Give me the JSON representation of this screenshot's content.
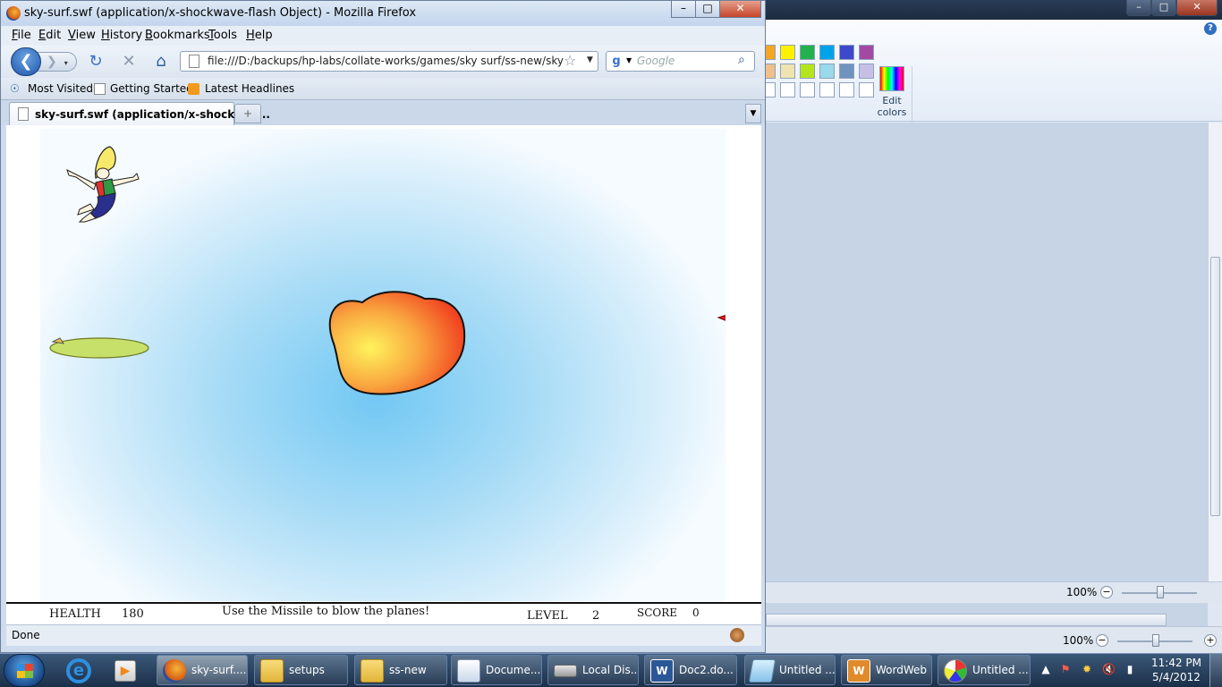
{
  "paint": {
    "edit_colors_label": "Edit\ncolors",
    "zoom_status": "100%",
    "zoom_bottom": "100%",
    "palette_row1": [
      "#f5a623",
      "#fff200",
      "#22b14c",
      "#00a2e8",
      "#3f48cc",
      "#a349a4"
    ],
    "palette_row2": [
      "#f0c08a",
      "#efe4b0",
      "#b5e61d",
      "#99d9ea",
      "#7092be",
      "#c8bfe7"
    ],
    "palette_row3": [
      "#ffffff",
      "#ffffff",
      "#ffffff",
      "#ffffff",
      "#ffffff",
      "#ffffff"
    ]
  },
  "firefox": {
    "window_title": "sky-surf.swf (application/x-shockwave-flash Object) - Mozilla Firefox",
    "menu": [
      {
        "accel": "F",
        "rest": "ile"
      },
      {
        "accel": "E",
        "rest": "dit"
      },
      {
        "accel": "V",
        "rest": "iew"
      },
      {
        "accel": "H",
        "rest": "istory"
      },
      {
        "accel": "B",
        "rest": "ookmarks"
      },
      {
        "accel": "T",
        "rest": "ools"
      },
      {
        "accel": "H",
        "rest": "elp"
      }
    ],
    "url": "file:///D:/backups/hp-labs/collate-works/games/sky surf/ss-new/sky-surf.swf",
    "search_placeholder": "Google",
    "bookmarks": [
      "Most Visited",
      "Getting Started",
      "Latest Headlines"
    ],
    "tab_title": "sky-surf.swf (application/x-shockwav...",
    "new_tab_symbol": "+",
    "status": "Done"
  },
  "game": {
    "health_label": "HEALTH",
    "health_value": "180",
    "message": "Use the Missile to blow the planes!",
    "level_label": "LEVEL",
    "level_value": "2",
    "score_label": "SCORE",
    "score_value": "0"
  },
  "taskbar": {
    "items": [
      {
        "label": "sky-surf....",
        "icon": "firefox-icon",
        "active": true
      },
      {
        "label": "setups",
        "icon": "folder-icon",
        "active": false
      },
      {
        "label": "ss-new",
        "icon": "folder-icon",
        "active": false
      },
      {
        "label": "Docume...",
        "icon": "documents-icon",
        "active": false
      },
      {
        "label": "Local Dis...",
        "icon": "drive-icon",
        "active": false
      },
      {
        "label": "Doc2.do...",
        "icon": "word-icon",
        "active": false
      },
      {
        "label": "Untitled ...",
        "icon": "notepad-icon",
        "active": false
      },
      {
        "label": "WordWeb",
        "icon": "wordweb-icon",
        "active": false
      },
      {
        "label": "Untitled ...",
        "icon": "paint-icon",
        "active": false
      }
    ],
    "time": "11:42 PM",
    "date": "5/4/2012"
  },
  "colors": {
    "taskbar": "#1b2f49",
    "firefox_chrome": "#cfdcee",
    "sky": "#72c8f4",
    "hud_text": "#111111"
  }
}
